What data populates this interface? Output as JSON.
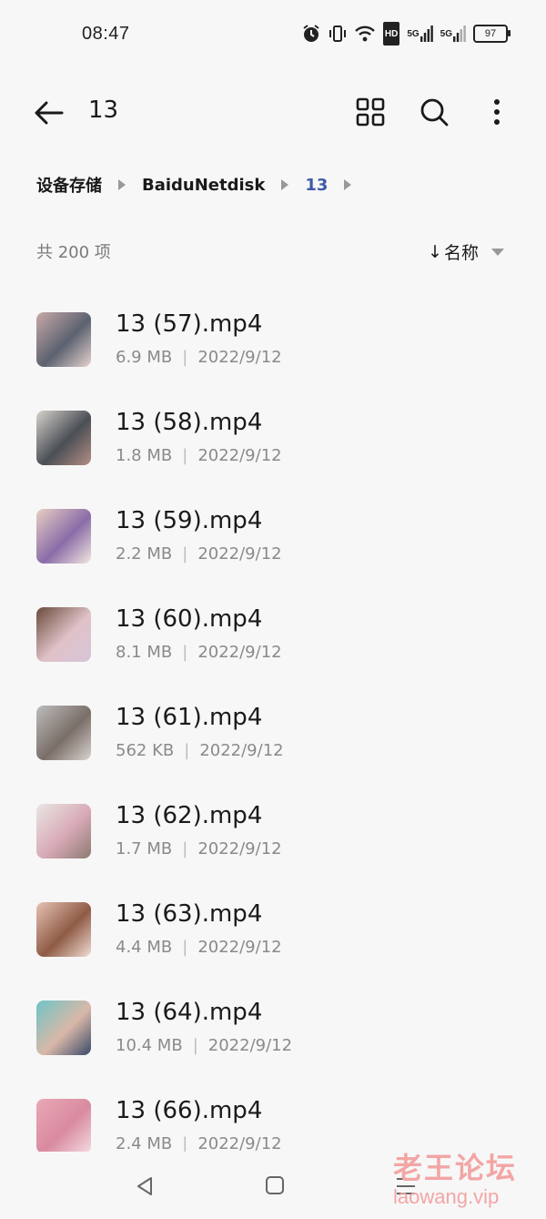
{
  "status_bar": {
    "time": "08:47",
    "icons": [
      "alarm-icon",
      "vibrate-icon",
      "wifi-icon",
      "hd-icon",
      "signal-5g-icon",
      "signal-5g-icon"
    ],
    "hd_label": "HD",
    "sig1_label": "5G",
    "sig2_label": "5G",
    "battery": "97"
  },
  "header": {
    "title": "13",
    "icons": [
      "back-arrow-icon",
      "grid-view-icon",
      "search-icon",
      "more-vert-icon"
    ]
  },
  "breadcrumb": [
    "设备存储",
    "BaiduNetdisk",
    "13"
  ],
  "summary": {
    "count": "共 200 项",
    "sort_label": "名称",
    "sort_arrow": "↓"
  },
  "files": [
    {
      "name": "13 (57).mp4",
      "size": "6.9 MB",
      "date": "2022/9/12",
      "thumb_colors": [
        "#c9a9a8",
        "#5b6270",
        "#e7d3cf"
      ]
    },
    {
      "name": "13 (58).mp4",
      "size": "1.8 MB",
      "date": "2022/9/12",
      "thumb_colors": [
        "#d8d2cc",
        "#4a4f55",
        "#b48f83"
      ]
    },
    {
      "name": "13 (59).mp4",
      "size": "2.2 MB",
      "date": "2022/9/12",
      "thumb_colors": [
        "#e8cfc3",
        "#8a6ca8",
        "#f3e6df"
      ]
    },
    {
      "name": "13 (60).mp4",
      "size": "8.1 MB",
      "date": "2022/9/12",
      "thumb_colors": [
        "#6a4a3a",
        "#e0c2c8",
        "#d7c5d9"
      ]
    },
    {
      "name": "13 (61).mp4",
      "size": "562 KB",
      "date": "2022/9/12",
      "thumb_colors": [
        "#bdbdbd",
        "#7a6e68",
        "#d9d3cf"
      ]
    },
    {
      "name": "13 (62).mp4",
      "size": "1.7 MB",
      "date": "2022/9/12",
      "thumb_colors": [
        "#e9e6e3",
        "#d8a9b6",
        "#8c7a72"
      ]
    },
    {
      "name": "13 (63).mp4",
      "size": "4.4 MB",
      "date": "2022/9/12",
      "thumb_colors": [
        "#e6c2b5",
        "#8f5b45",
        "#f0dcd3"
      ]
    },
    {
      "name": "13 (64).mp4",
      "size": "10.4 MB",
      "date": "2022/9/12",
      "thumb_colors": [
        "#6fc4c6",
        "#d9b8a8",
        "#3a4a6a"
      ]
    },
    {
      "name": "13 (66).mp4",
      "size": "2.4 MB",
      "date": "2022/9/12",
      "thumb_colors": [
        "#e9a9b6",
        "#d98aa0",
        "#f3dde2"
      ]
    }
  ],
  "nav_bar": {
    "icons": [
      "nav-back-icon",
      "nav-home-icon",
      "nav-menu-icon"
    ]
  },
  "watermark": {
    "text_cn": "老王论坛",
    "text_en": "laowang.vip"
  }
}
